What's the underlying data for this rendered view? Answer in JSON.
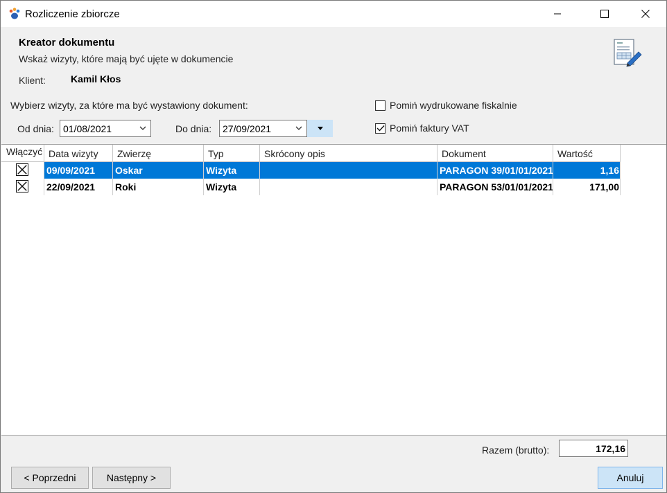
{
  "window": {
    "title": "Rozliczenie zbiorcze",
    "icon": "paw-icon"
  },
  "header": {
    "title": "Kreator dokumentu",
    "subtitle": "Wskaż wizyty, które mają być ujęte w dokumencie",
    "client_label": "Klient:",
    "client_name": "Kamil Kłos"
  },
  "filters": {
    "pick_label": "Wybierz wizyty, za które ma być wystawiony dokument:",
    "from_label": "Od dnia:",
    "from_value": "01/08/2021",
    "to_label": "Do dnia:",
    "to_value": "27/09/2021",
    "skip_fiscal_label": "Pomiń wydrukowane fiskalnie",
    "skip_fiscal_checked": false,
    "skip_vat_label": "Pomiń faktury VAT",
    "skip_vat_checked": true
  },
  "grid": {
    "columns": [
      "Włączyć",
      "Data wizyty",
      "Zwierzę",
      "Typ",
      "Skrócony opis",
      "Dokument",
      "Wartość"
    ],
    "rows": [
      {
        "include": true,
        "date": "09/09/2021",
        "animal": "Oskar",
        "type": "Wizyta",
        "desc": "",
        "document": "PARAGON 39/01/01/2021",
        "value": "1,16",
        "selected": true
      },
      {
        "include": true,
        "date": "22/09/2021",
        "animal": "Roki",
        "type": "Wizyta",
        "desc": "",
        "document": "PARAGON 53/01/01/2021",
        "value": "171,00",
        "selected": false
      }
    ]
  },
  "footer": {
    "total_label": "Razem (brutto):",
    "total_value": "172,16",
    "prev_button": "< Poprzedni",
    "next_button": "Następny >",
    "cancel_button": "Anuluj"
  },
  "colors": {
    "selection": "#0078d7",
    "accent_button": "#cce4f7"
  }
}
